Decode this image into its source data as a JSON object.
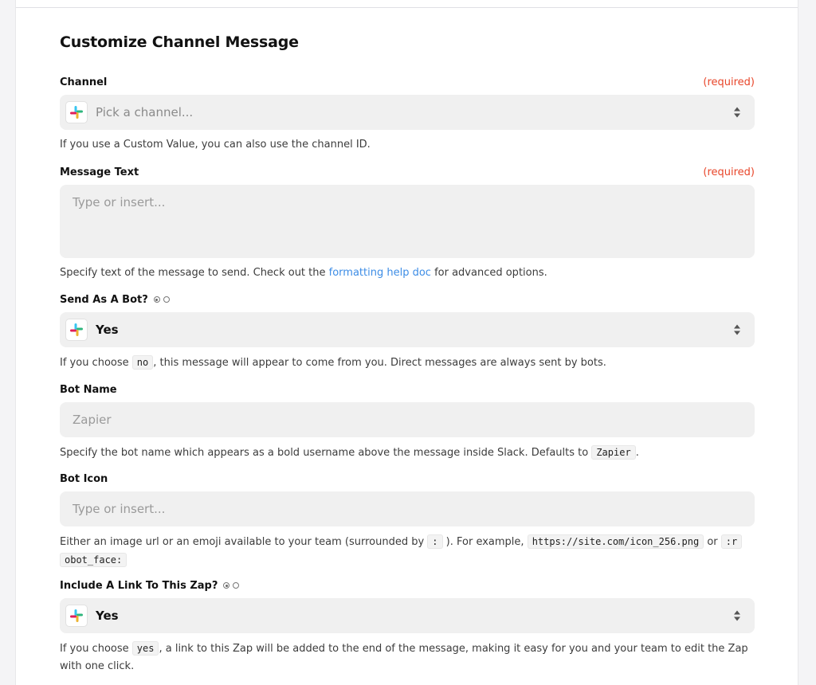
{
  "form": {
    "title": "Customize Channel Message",
    "required_text": "(required)",
    "channel": {
      "label": "Channel",
      "placeholder": "Pick a channel...",
      "help": "If you use a Custom Value, you can also use the channel ID."
    },
    "message_text": {
      "label": "Message Text",
      "placeholder": "Type or insert...",
      "help_before": "Specify text of the message to send. Check out the",
      "help_link": "formatting help doc",
      "help_after": "for advanced options."
    },
    "send_as_bot": {
      "label": "Send As A Bot?",
      "value": "Yes",
      "help_before": "If you choose",
      "help_code": "no",
      "help_after": ", this message will appear to come from you. Direct messages are always sent by bots."
    },
    "bot_name": {
      "label": "Bot Name",
      "placeholder": "Zapier",
      "help_before": "Specify the bot name which appears as a bold username above the message inside Slack. Defaults to",
      "help_code": "Zapier",
      "help_after": "."
    },
    "bot_icon": {
      "label": "Bot Icon",
      "placeholder": "Type or insert...",
      "help_before": "Either an image url or an emoji available to your team (surrounded by",
      "help_code1": ":",
      "help_mid": "). For example,",
      "help_code2": "https://site.com/icon_256.png",
      "help_or": "or",
      "help_code3a": ":r",
      "help_code3b": "obot_face:"
    },
    "include_link": {
      "label": "Include A Link To This Zap?",
      "value": "Yes",
      "help_before": "If you choose",
      "help_code": "yes",
      "help_after": ", a link to this Zap will be added to the end of the message, making it easy for you and your team to edit the Zap with one click."
    }
  },
  "icons": {
    "slack": "slack-logo-icon",
    "select_arrows": "up-down-arrows-icon",
    "radio": "radio-icon"
  },
  "colors": {
    "required": "#e8462a",
    "link": "#3d8de6",
    "field_bg": "#f0f0f0"
  }
}
